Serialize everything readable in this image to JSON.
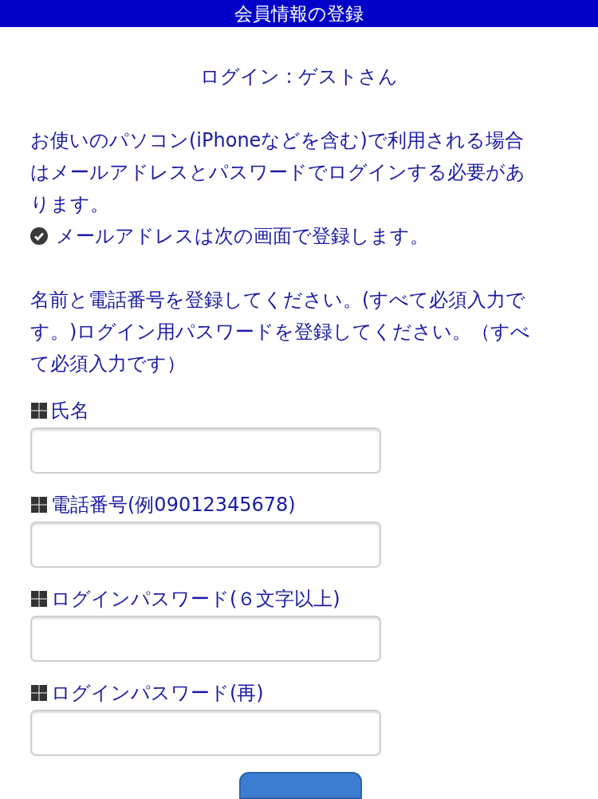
{
  "header": {
    "title": "会員情報の登録"
  },
  "login_status": "ログイン : ゲストさん",
  "intro": {
    "paragraph": "お使いのパソコン(iPhoneなどを含む)で利用される場合はメールアドレスとパスワードでログインする必要があります。",
    "note": "メールアドレスは次の画面で登録します。"
  },
  "instructions": "名前と電話番号を登録してください。(すべて必須入力です。)ログイン用パスワードを登録してください。（すべて必須入力です）",
  "fields": [
    {
      "label": "氏名"
    },
    {
      "label": "電話番号(例09012345678)"
    },
    {
      "label": "ログインパスワード(６文字以上)"
    },
    {
      "label": "ログインパスワード(再)"
    }
  ]
}
